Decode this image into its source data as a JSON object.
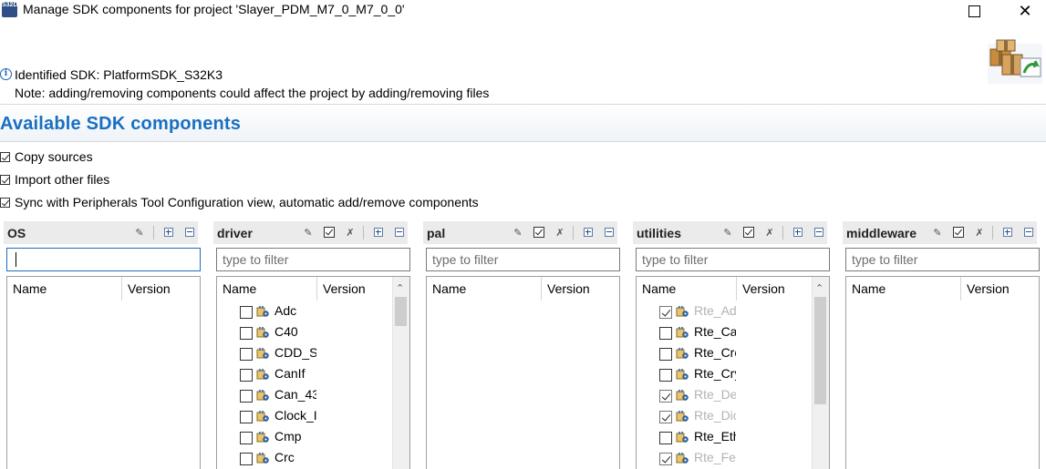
{
  "window": {
    "title": "Manage SDK components for project 'Slayer_PDM_M7_0_M7_0_0'",
    "app_icon_text": "S32DS",
    "maximize_label": "",
    "close_label": "✕"
  },
  "header": {
    "info_icon": "info-icon",
    "sdk_line": "Identified SDK: PlatformSDK_S32K3",
    "note_line": "Note: adding/removing components could affect the project by adding/removing files",
    "section_title": "Available SDK components"
  },
  "options": [
    {
      "label": "Copy sources",
      "checked": true
    },
    {
      "label": "Import other files",
      "checked": true
    },
    {
      "label": "Sync with Peripherals Tool Configuration view, automatic add/remove components",
      "checked": true
    }
  ],
  "columns": {
    "name": "Name",
    "version": "Version"
  },
  "panels": [
    {
      "title": "OS",
      "filter_value": "",
      "filter_placeholder": "",
      "items": []
    },
    {
      "title": "driver",
      "filter_value": "",
      "filter_placeholder": "type to filter",
      "items": [
        {
          "label": "Adc",
          "checked": false,
          "dim": false
        },
        {
          "label": "C40",
          "checked": false,
          "dim": false
        },
        {
          "label": "CDD_S",
          "checked": false,
          "dim": false
        },
        {
          "label": "CanIf",
          "checked": false,
          "dim": false
        },
        {
          "label": "Can_43",
          "checked": false,
          "dim": false
        },
        {
          "label": "Clock_I",
          "checked": false,
          "dim": false
        },
        {
          "label": "Cmp",
          "checked": false,
          "dim": false
        },
        {
          "label": "Crc",
          "checked": false,
          "dim": false
        }
      ]
    },
    {
      "title": "pal",
      "filter_value": "",
      "filter_placeholder": "type to filter",
      "items": []
    },
    {
      "title": "utilities",
      "filter_value": "",
      "filter_placeholder": "type to filter",
      "items": [
        {
          "label": "Rte_Ad",
          "checked": true,
          "dim": true
        },
        {
          "label": "Rte_Ca",
          "checked": false,
          "dim": false
        },
        {
          "label": "Rte_Crc",
          "checked": false,
          "dim": false
        },
        {
          "label": "Rte_Cry",
          "checked": false,
          "dim": false
        },
        {
          "label": "Rte_De",
          "checked": true,
          "dim": true
        },
        {
          "label": "Rte_Dio",
          "checked": true,
          "dim": true
        },
        {
          "label": "Rte_Eth",
          "checked": false,
          "dim": false
        },
        {
          "label": "Rte_Fe",
          "checked": true,
          "dim": true
        }
      ]
    },
    {
      "title": "middleware",
      "filter_value": "",
      "filter_placeholder": "type to filter",
      "items": []
    }
  ]
}
